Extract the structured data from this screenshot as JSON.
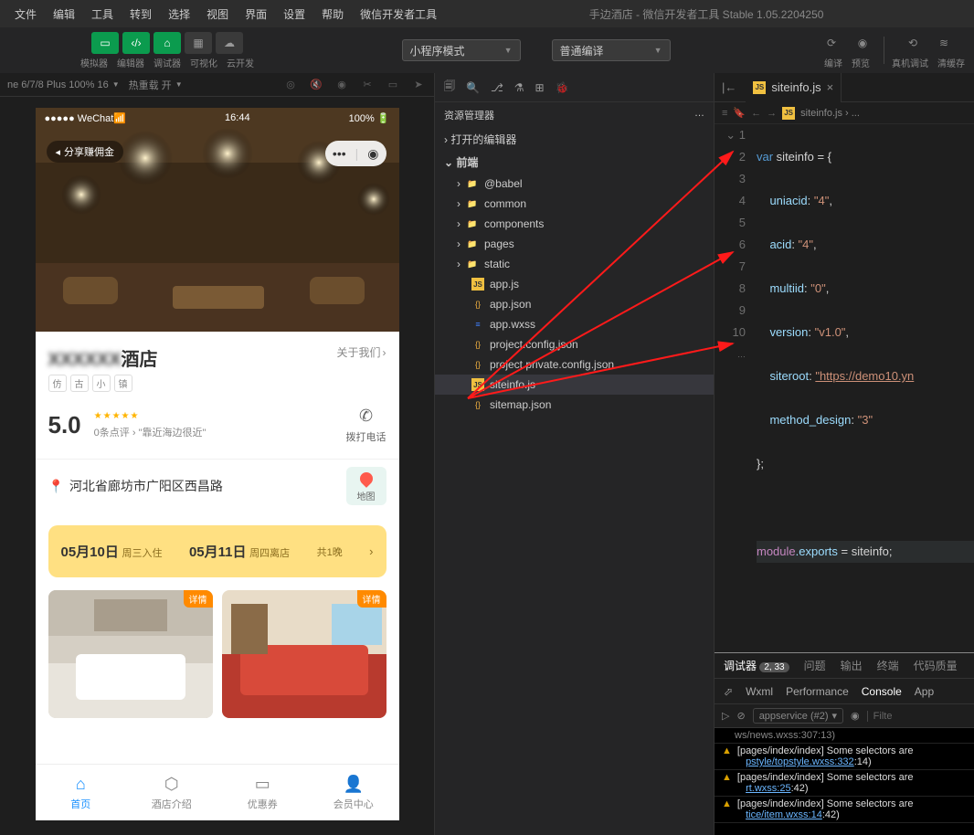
{
  "menubar": [
    "文件",
    "编辑",
    "工具",
    "转到",
    "选择",
    "视图",
    "界面",
    "设置",
    "帮助",
    "微信开发者工具"
  ],
  "windowTitle": "手边酒店 - 微信开发者工具 Stable 1.05.2204250",
  "toolbar": {
    "greenLabels": [
      "模拟器",
      "编辑器",
      "调试器"
    ],
    "grayLabels": [
      "可视化",
      "云开发"
    ],
    "modeDropdown": "小程序模式",
    "compileDropdown": "普通编译",
    "rightLabels": [
      "编译",
      "预览",
      "真机调试",
      "清缓存"
    ]
  },
  "simInfo": {
    "device": "ne 6/7/8 Plus 100% 16",
    "hot": "热重载 开"
  },
  "phone": {
    "statusLeft": "●●●●● WeChat",
    "time": "16:44",
    "battery": "100%",
    "sharePill": "分享赚佣金",
    "hotelNameBlur": "XXXXXX",
    "hotelNameSuffix": "酒店",
    "aboutUs": "关于我们",
    "tags": [
      "仿",
      "古",
      "小",
      "镇"
    ],
    "rating": "5.0",
    "reviews": "0条点评",
    "slogan": "\"靠近海边很近\"",
    "call": "拨打电话",
    "location": "河北省廊坊市广阳区西昌路",
    "mapLabel": "地图",
    "checkin": "05月10日",
    "checkinLabel": "周三入住",
    "checkout": "05月11日",
    "checkoutLabel": "周四离店",
    "nights": "共1晚",
    "roomBadge": "详情",
    "tabs": [
      {
        "label": "首页",
        "active": true
      },
      {
        "label": "酒店介绍",
        "active": false
      },
      {
        "label": "优惠券",
        "active": false
      },
      {
        "label": "会员中心",
        "active": false
      }
    ]
  },
  "explorer": {
    "title": "资源管理器",
    "openEditors": "打开的编辑器",
    "root": "前端",
    "folders": [
      "@babel",
      "common",
      "components",
      "pages",
      "static"
    ],
    "files": [
      {
        "name": "app.js",
        "type": "js"
      },
      {
        "name": "app.json",
        "type": "json"
      },
      {
        "name": "app.wxss",
        "type": "wxss"
      },
      {
        "name": "project.config.json",
        "type": "json"
      },
      {
        "name": "project.private.config.json",
        "type": "json"
      },
      {
        "name": "siteinfo.js",
        "type": "js",
        "selected": true
      },
      {
        "name": "sitemap.json",
        "type": "json"
      }
    ]
  },
  "editor": {
    "tabName": "siteinfo.js",
    "breadcrumb": "siteinfo.js › ...",
    "lines": [
      1,
      2,
      3,
      4,
      5,
      6,
      7,
      8,
      9,
      10
    ],
    "code": {
      "l1_kw": "var",
      "l1_rest": " siteinfo = {",
      "l2_p": "uniacid",
      "l2_v": "\"4\"",
      "l3_p": "acid",
      "l3_v": "\"4\"",
      "l4_p": "multiid",
      "l4_v": "\"0\"",
      "l5_p": "version",
      "l5_v": "\"v1.0\"",
      "l6_p": "siteroot",
      "l6_v": "\"https://demo10.yn",
      "l7_p": "method_design",
      "l7_v": "\"3\"",
      "l8": "};",
      "l10_a": "module",
      "l10_b": ".exports",
      "l10_c": " = siteinfo;"
    }
  },
  "debug": {
    "tabs": [
      "调试器",
      "问题",
      "输出",
      "终端",
      "代码质量"
    ],
    "badge": "2, 33",
    "innerTabs": [
      "Wxml",
      "Performance",
      "Console",
      "App"
    ],
    "filterContext": "appservice (#2)",
    "filterPlaceholder": "Filte",
    "cutline": "ws/news.wxss:307:13)",
    "warnings": [
      {
        "t": "[pages/index/index] Some selectors are",
        "l": "pstyle/topstyle.wxss:332",
        "s": ":14)"
      },
      {
        "t": "[pages/index/index] Some selectors are",
        "l": "rt.wxss:25",
        "s": ":42)"
      },
      {
        "t": "[pages/index/index] Some selectors are",
        "l": "tice/item.wxss:14",
        "s": ":42)"
      }
    ]
  }
}
